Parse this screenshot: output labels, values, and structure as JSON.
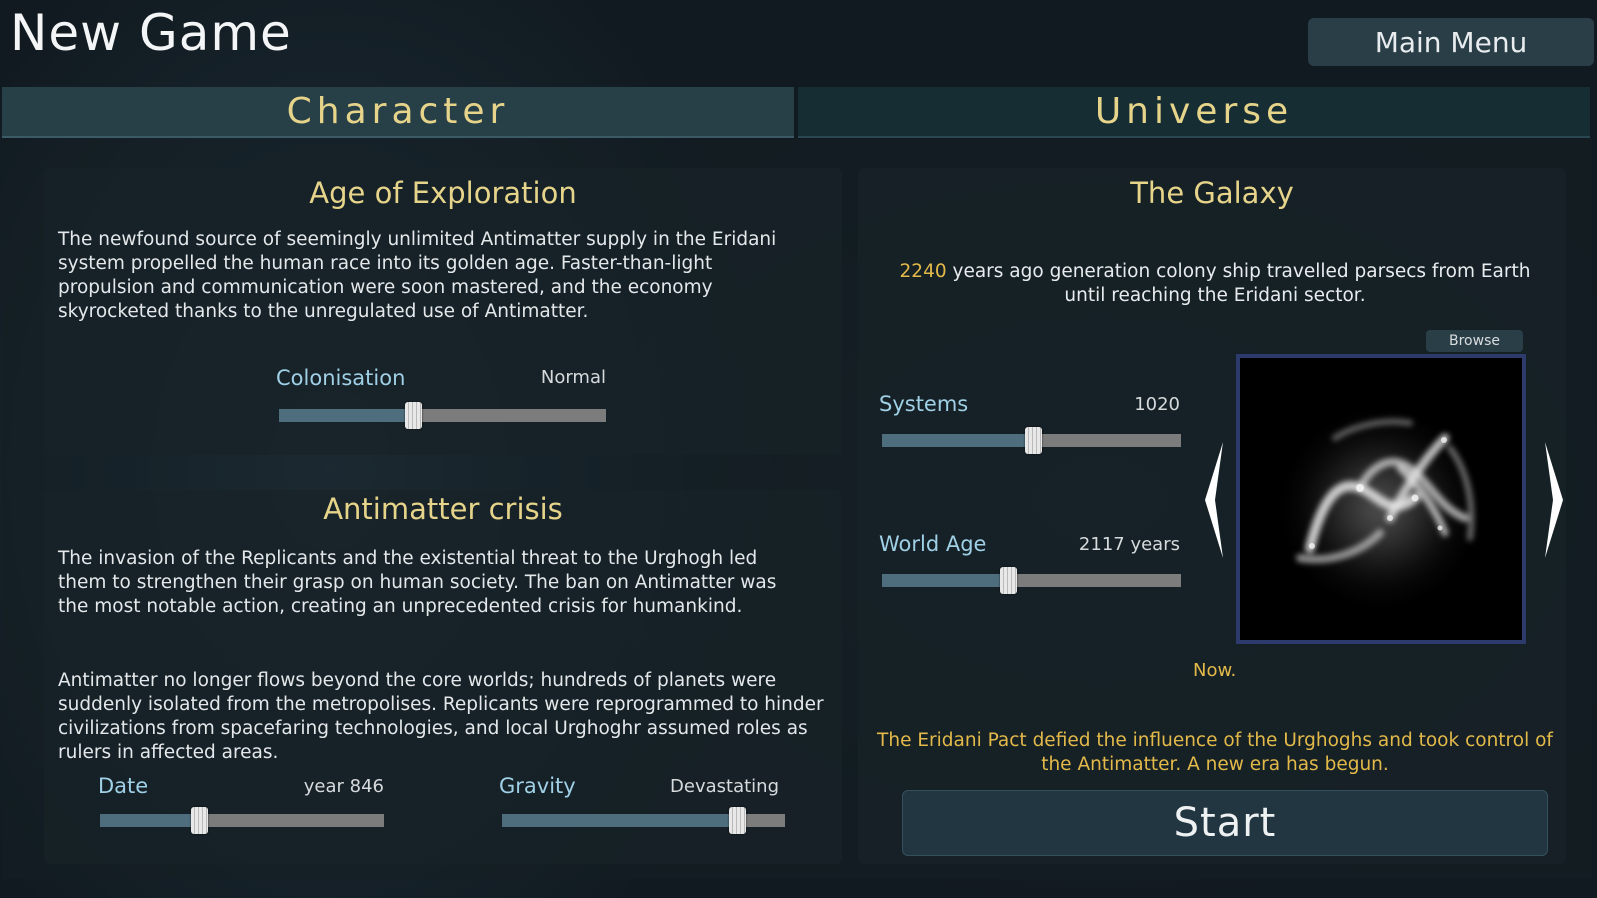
{
  "header": {
    "title": "New Game",
    "main_menu_label": "Main Menu"
  },
  "tabs": [
    {
      "label": "Character",
      "active": true
    },
    {
      "label": "Universe",
      "active": false
    }
  ],
  "character": {
    "exploration": {
      "title": "Age of Exploration",
      "description": "The newfound source of seemingly unlimited Antimatter supply in the Eridani system propelled the human race into its golden age. Faster-than-light propulsion and communication were soon mastered, and the economy skyrocketed thanks to the unregulated use of Antimatter.",
      "colonisation": {
        "label": "Colonisation",
        "value": "Normal",
        "level": 0.41
      }
    },
    "crisis": {
      "title": "Antimatter crisis",
      "paragraph1": "The invasion of the Replicants and the existential threat to the Urghogh led them to strengthen their grasp on human society. The ban on Antimatter was the most notable action, creating an unprecedented crisis for humankind.",
      "paragraph2": "Antimatter no longer flows beyond the core worlds; hundreds of planets were suddenly isolated from the metropolises. Replicants were reprogrammed to hinder civilizations from spacefaring technologies, and local Urghoghr assumed roles as rulers in affected areas.",
      "date": {
        "label": "Date",
        "value": "year 846",
        "level": 0.35
      },
      "gravity": {
        "label": "Gravity",
        "value": "Devastating",
        "level": 0.83
      }
    }
  },
  "universe": {
    "title": "The Galaxy",
    "intro_years": "2240",
    "intro_line1_rest": " years ago generation colony ship travelled parsecs from Earth",
    "intro_line2": "until reaching the Eridani sector.",
    "systems": {
      "label": "Systems",
      "value": "1020",
      "level": 0.505
    },
    "world_age": {
      "label": "World Age",
      "value": "2117 years",
      "level": 0.42
    },
    "browse_label": "Browse",
    "now_label": "Now.",
    "outro": "The Eridani Pact defied the influence of the Urghoghs and took control of the Antimatter. A new era has begun.",
    "start_label": "Start"
  },
  "colors": {
    "accent_gold": "#e6d48a",
    "highlight_orange": "#e3b94a",
    "slider_fill": "#4e6e7e",
    "slider_track": "#7c7c7c",
    "label_blue": "#9fd0e6"
  }
}
